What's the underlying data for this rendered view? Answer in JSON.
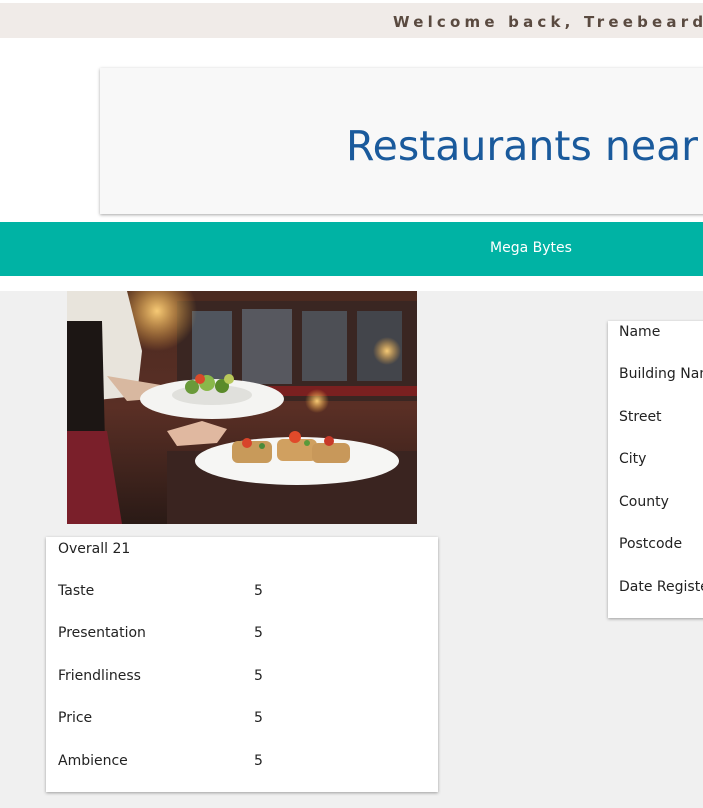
{
  "header": {
    "welcome": "Welcome back, Treebeard"
  },
  "title": "Restaurants near yo",
  "nav": {
    "items": [
      {
        "label": "Mega Bytes"
      }
    ]
  },
  "ratings": {
    "overall": "Overall 21",
    "rows": [
      {
        "label": "Taste",
        "value": "5"
      },
      {
        "label": "Presentation",
        "value": "5"
      },
      {
        "label": "Friendliness",
        "value": "5"
      },
      {
        "label": "Price",
        "value": "5"
      },
      {
        "label": "Ambience",
        "value": "5"
      }
    ]
  },
  "details": {
    "labels": [
      "Name",
      "Building Nam",
      "Street",
      "City",
      "County",
      "Postcode",
      "Date Registe"
    ]
  },
  "colors": {
    "accent": "#00b3a4",
    "title": "#1a5a9c",
    "welcome_bg": "#f0ebe8",
    "welcome_text": "#5a4a40"
  }
}
